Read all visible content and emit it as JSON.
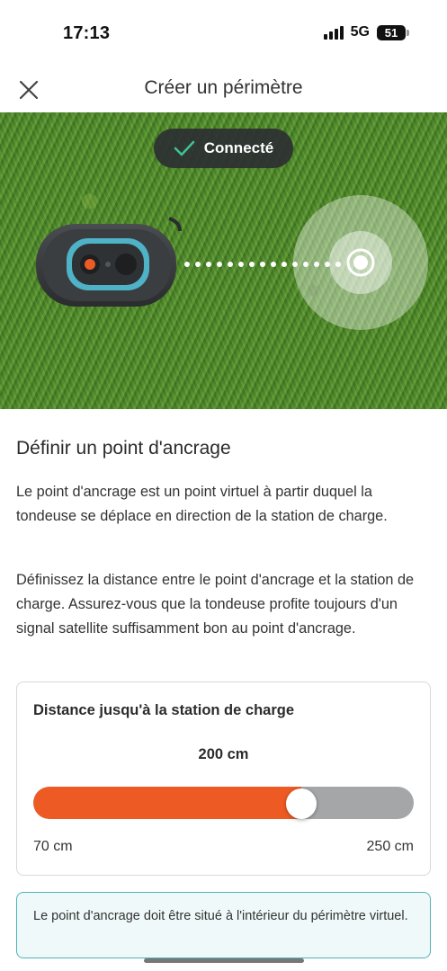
{
  "status_bar": {
    "time": "17:13",
    "network": "5G",
    "battery": "51"
  },
  "header": {
    "title": "Créer un périmètre",
    "close_icon": "close-icon"
  },
  "hero": {
    "status_pill": "Connecté",
    "check_icon": "check-icon",
    "mower_icon": "robot-mower-icon",
    "anchor_icon": "anchor-point-icon"
  },
  "content": {
    "section_title": "Définir un point d'ancrage",
    "paragraph_1": "Le point d'ancrage est un point virtuel à partir duquel la tondeuse se déplace en direction de la station de charge.",
    "paragraph_2": "Définissez la distance entre le point d'ancrage et la station de charge. Assurez-vous que la tondeuse profite toujours d'un signal satellite suffisamment bon au point d'ancrage."
  },
  "slider": {
    "title": "Distance jusqu'à la station de charge",
    "value_label": "200 cm",
    "value": 200,
    "min": 70,
    "max": 250,
    "min_label": "70 cm",
    "max_label": "250 cm",
    "fill_color": "#ee5a24",
    "track_color": "#a4a6a8"
  },
  "info": {
    "text": "Le point d'ancrage doit être situé à l'intérieur du périmètre virtuel.",
    "border_color": "#4fb3b8"
  }
}
